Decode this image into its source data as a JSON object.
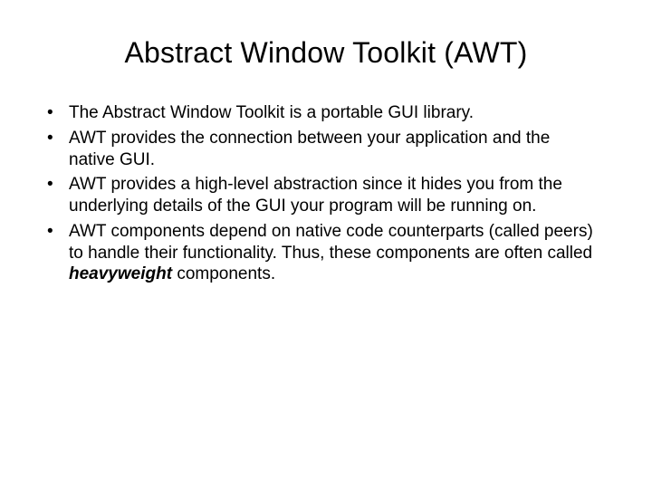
{
  "slide": {
    "title": "Abstract Window Toolkit (AWT)",
    "bullets": [
      {
        "text": "The Abstract Window Toolkit is a portable GUI library."
      },
      {
        "text": "AWT provides the connection between your application and the native GUI."
      },
      {
        "text": "AWT provides a high-level abstraction since it hides you from the underlying details of the GUI your program will be running on."
      },
      {
        "prefix": "AWT components depend on native code counterparts (called peers) to handle their functionality.  Thus, these components are often called ",
        "em": "heavyweight",
        "suffix": " components."
      }
    ]
  }
}
